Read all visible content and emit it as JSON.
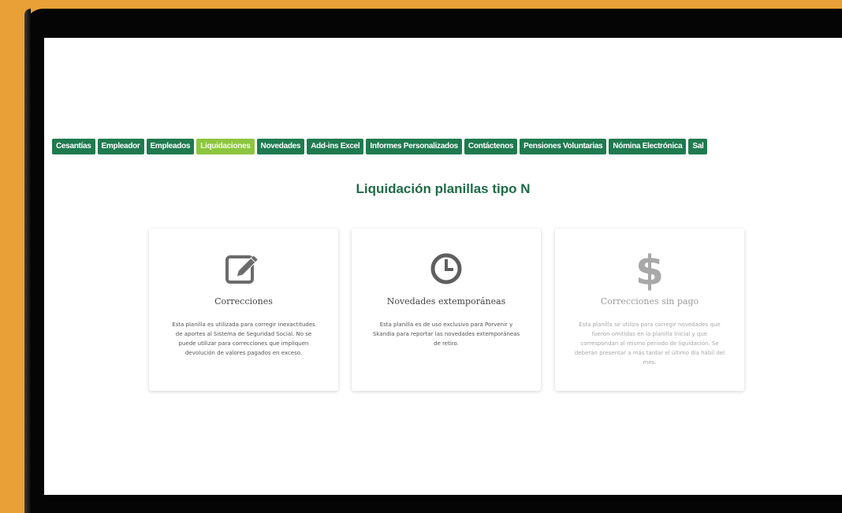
{
  "nav": {
    "tabs": [
      {
        "label": "Cesantías"
      },
      {
        "label": "Empleador"
      },
      {
        "label": "Empleados"
      },
      {
        "label": "Liquidaciones"
      },
      {
        "label": "Novedades"
      },
      {
        "label": "Add-ins Excel"
      },
      {
        "label": "Informes Personalizados"
      },
      {
        "label": "Contáctenos"
      },
      {
        "label": "Pensiones Voluntarias"
      },
      {
        "label": "Nómina Electrónica"
      },
      {
        "label": "Sal"
      }
    ],
    "active_tab": "Liquidaciones"
  },
  "page": {
    "title": "Liquidación planillas tipo N"
  },
  "cards": [
    {
      "title": "Correcciones",
      "icon": "edit-icon",
      "description": "Esta planilla es utilizada para corregir inexactitudes de aportes al Sistema de Seguridad Social. No se puede utilizar para correcciones que impliquen devolución de valores pagados en exceso."
    },
    {
      "title": "Novedades extemporáneas",
      "icon": "clock-icon",
      "description": "Esta planilla es de uso exclusivo para Porvenir y Skandia para reportar las novedades extemporáneas de retiro."
    },
    {
      "title": "Correcciones sin pago",
      "icon": "dollar-icon",
      "description": "Esta planilla se utiliza para corregir novedades que fueron omitidas en la planilla inicial y que correspondan al mismo periodo de liquidación. Se deberán presentar a más tardar el último día hábil del mes."
    }
  ],
  "colors": {
    "background": "#e9a036",
    "tab": "#1f7a4f",
    "tab_active": "#8cc63f",
    "title": "#1e6b47"
  }
}
